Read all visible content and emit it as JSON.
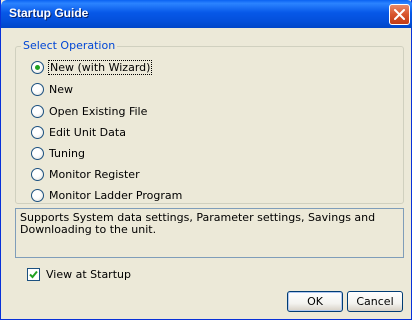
{
  "window": {
    "title": "Startup Guide"
  },
  "group": {
    "legend": "Select Operation",
    "options": [
      {
        "label": "New (with Wizard)",
        "checked": true
      },
      {
        "label": "New",
        "checked": false
      },
      {
        "label": "Open Existing File",
        "checked": false
      },
      {
        "label": "Edit Unit Data",
        "checked": false
      },
      {
        "label": "Tuning",
        "checked": false
      },
      {
        "label": "Monitor Register",
        "checked": false
      },
      {
        "label": "Monitor Ladder Program",
        "checked": false
      }
    ]
  },
  "description": "Supports System data settings, Parameter settings, Savings and Downloading to the unit.",
  "view_at_startup": {
    "label": "View at Startup",
    "checked": true
  },
  "buttons": {
    "ok": "OK",
    "cancel": "Cancel"
  },
  "colors": {
    "titlebar": "#0758e8",
    "legend": "#0046d5",
    "radio_dot": "#21a121",
    "dialog_bg": "#ece9d8"
  }
}
